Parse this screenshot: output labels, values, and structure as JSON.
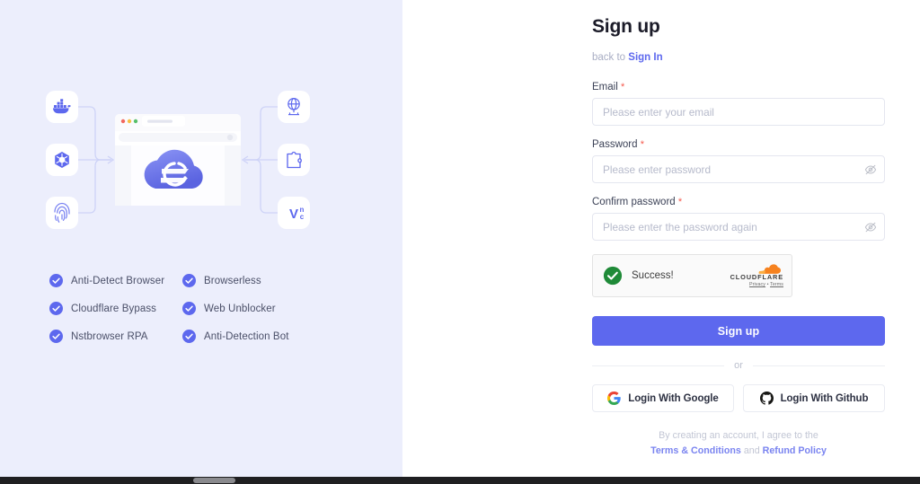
{
  "left": {
    "illustration": {
      "name": "nstbrowser-architecture-illustration",
      "left_icons": [
        "docker-icon",
        "kubernetes-icon",
        "fingerprint-icon"
      ],
      "right_icons": [
        "globe-network-icon",
        "puzzle-plugin-icon",
        "vnc-icon"
      ],
      "center": "browser-window-with-cloud-logo"
    },
    "features": [
      "Anti-Detect Browser",
      "Browserless",
      "Cloudflare Bypass",
      "Web Unblocker",
      "Nstbrowser RPA",
      "Anti-Detection Bot"
    ]
  },
  "form": {
    "title": "Sign up",
    "back_prefix": "back to ",
    "back_link": "Sign In",
    "email": {
      "label": "Email",
      "required_mark": "*",
      "placeholder": "Please enter your email",
      "value": ""
    },
    "password": {
      "label": "Password",
      "required_mark": "*",
      "placeholder": "Please enter password",
      "value": "",
      "toggle_icon": "eye-off-icon"
    },
    "confirm_password": {
      "label": "Confirm password",
      "required_mark": "*",
      "placeholder": "Please enter the password again",
      "value": "",
      "toggle_icon": "eye-off-icon"
    },
    "captcha": {
      "status": "Success!",
      "brand": "CLOUDFLARE",
      "privacy": "Privacy",
      "separator": " • ",
      "terms": "Terms",
      "check_icon": "green-check-circle-icon",
      "logo_icon": "cloudflare-cloud-icon"
    },
    "submit_label": "Sign up",
    "divider_label": "or",
    "social": [
      {
        "label": "Login With Google",
        "icon": "google-g-icon"
      },
      {
        "label": "Login With Github",
        "icon": "github-mark-icon"
      }
    ],
    "legal": {
      "line1": "By creating an account, I agree to the",
      "terms": "Terms & Conditions",
      "and": " and ",
      "refund": "Refund Policy"
    }
  },
  "colors": {
    "accent": "#5d68ee",
    "panel_bg": "#eceefc",
    "required": "#f5584b",
    "success": "#1f8a38",
    "cloudflare_orange": "#f6821f"
  }
}
